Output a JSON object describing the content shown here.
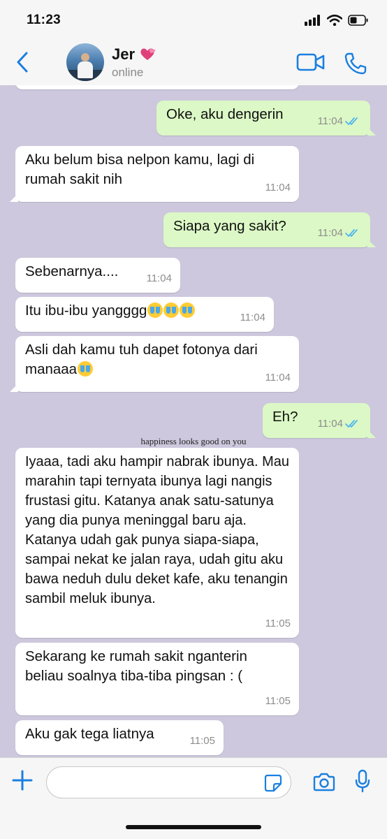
{
  "status_bar": {
    "time": "11:23"
  },
  "header": {
    "contact_name": "Jer",
    "contact_status": "online"
  },
  "watermark": "happiness looks good on you",
  "messages": [
    {
      "dir": "out",
      "text": "Oke, aku dengerin",
      "time": "11:04"
    },
    {
      "dir": "in",
      "text": "Aku belum bisa nelpon kamu, lagi di rumah sakit nih",
      "time": "11:04"
    },
    {
      "dir": "out",
      "text": "Siapa yang sakit?",
      "time": "11:04"
    },
    {
      "dir": "in",
      "text": "Sebenarnya....",
      "time": "11:04"
    },
    {
      "dir": "in",
      "text": "Itu ibu-ibu yangggg",
      "emoji_count": 3,
      "time": "11:04"
    },
    {
      "dir": "in",
      "text": "Asli dah kamu tuh dapet fotonya dari manaaa",
      "emoji_count": 1,
      "time": "11:04"
    },
    {
      "dir": "out",
      "text": "Eh?",
      "time": "11:04"
    },
    {
      "dir": "in",
      "text": "Iyaaa, tadi aku hampir nabrak ibunya. Mau marahin tapi ternyata ibunya lagi nangis frustasi gitu. Katanya anak satu-satunya yang dia punya meninggal baru aja. Katanya udah gak punya siapa-siapa, sampai nekat ke jalan raya, udah gitu aku bawa neduh dulu deket kafe, aku tenangin sambil meluk ibunya.",
      "time": "11:05"
    },
    {
      "dir": "in",
      "text": "Sekarang ke rumah sakit nganterin beliau soalnya tiba-tiba pingsan : (",
      "time": "11:05"
    },
    {
      "dir": "in",
      "text": "Aku gak tega liatnya",
      "time": "11:05"
    }
  ],
  "input": {
    "value": ""
  },
  "icons": [
    "back-chevron-icon",
    "video-call-icon",
    "phone-icon",
    "plus-icon",
    "sticker-icon",
    "camera-icon",
    "microphone-icon",
    "signal-icon",
    "wifi-icon",
    "battery-icon",
    "double-check-icon",
    "hearts-emoji-icon",
    "crying-emoji-icon"
  ],
  "colors": {
    "accent": "#1a7fe0",
    "outgoing_bubble": "#dcf8c6",
    "incoming_bubble": "#ffffff",
    "chat_background": "#cdc8dd",
    "read_ticks": "#4fb6ec"
  }
}
